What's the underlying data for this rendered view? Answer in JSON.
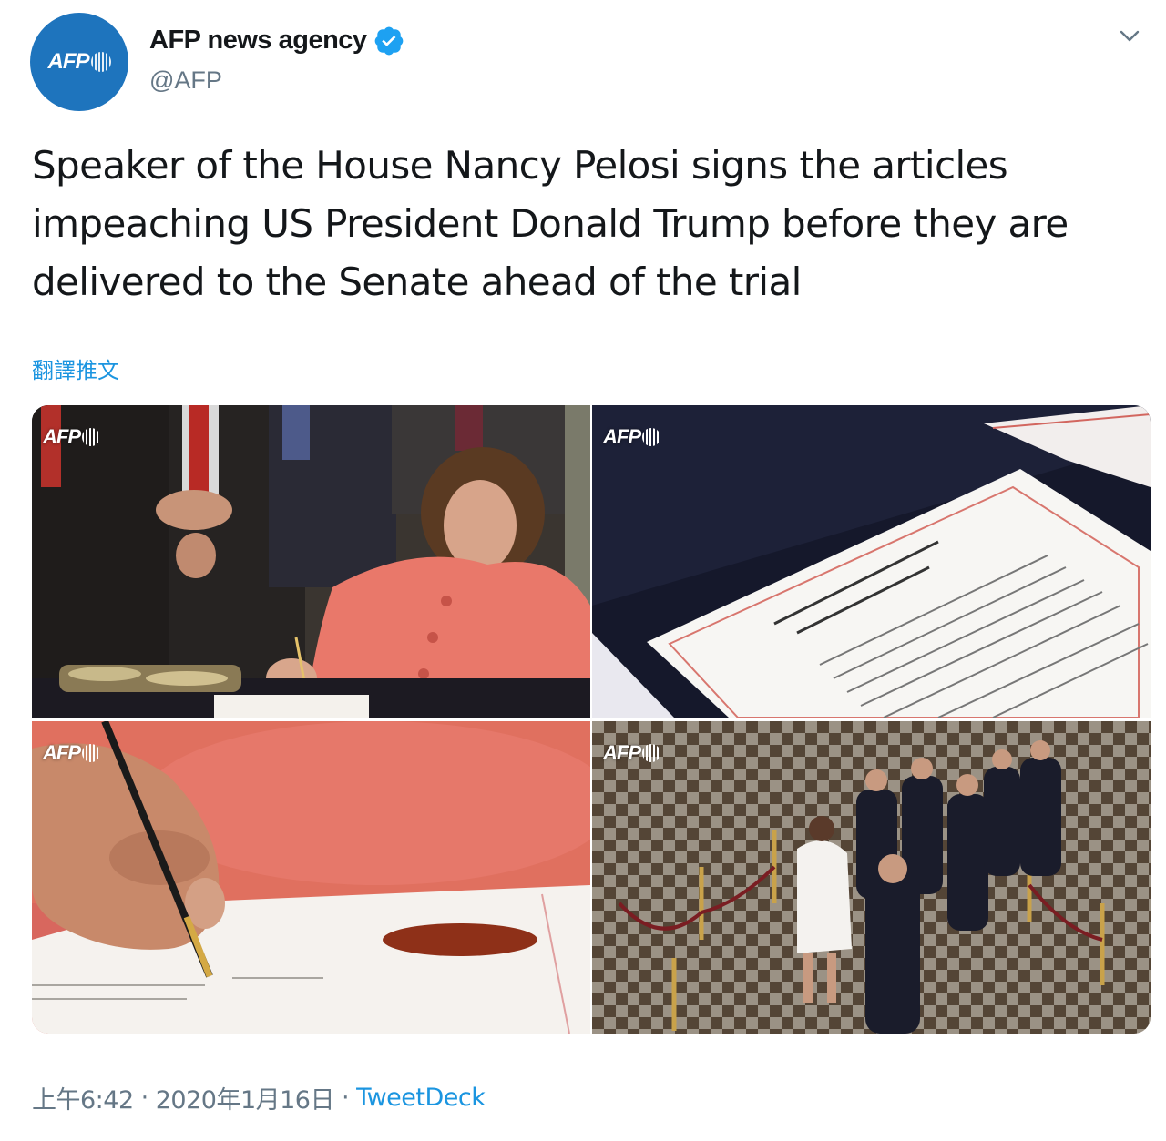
{
  "author": {
    "display_name": "AFP news agency",
    "handle": "@AFP",
    "avatar_logo": "AFP",
    "verified": true
  },
  "tweet": {
    "text": "Speaker of the House Nancy Pelosi signs the articles impeaching US President Donald Trump before they are delivered to the Senate ahead of the trial",
    "translate_label": "翻譯推文"
  },
  "media": {
    "watermark": "AFP",
    "photos": [
      {
        "subject": "Nancy Pelosi signing at table"
      },
      {
        "subject": "Articles of Impeachment document"
      },
      {
        "subject": "Hand signing with gold pen"
      },
      {
        "subject": "Procession through Statuary Hall"
      }
    ]
  },
  "meta": {
    "time": "上午6:42",
    "separator": "·",
    "date": "2020年1月16日",
    "source": "TweetDeck"
  },
  "colors": {
    "brand_blue": "#1e74bd",
    "link_blue": "#1b95e0",
    "secondary_text": "#657786",
    "primary_text": "#14171a"
  },
  "icons": {
    "verified": "verified-badge-icon",
    "menu": "chevron-down-icon"
  }
}
